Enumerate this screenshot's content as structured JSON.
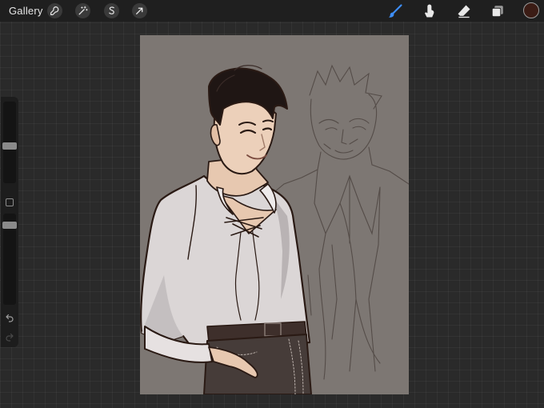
{
  "toolbar": {
    "gallery_label": "Gallery",
    "left_tools": [
      {
        "icon": "wrench-icon",
        "name": "actions"
      },
      {
        "icon": "magic-wand-icon",
        "name": "adjustments"
      },
      {
        "icon": "selection-s-icon",
        "name": "selection"
      },
      {
        "icon": "arrow-cursor-icon",
        "name": "transform"
      }
    ],
    "right_tools": [
      {
        "icon": "brush-icon",
        "name": "paint",
        "active": true
      },
      {
        "icon": "smudge-finger-icon",
        "name": "smudge",
        "active": false
      },
      {
        "icon": "eraser-icon",
        "name": "eraser",
        "active": false
      },
      {
        "icon": "layers-icon",
        "name": "layers",
        "active": false
      }
    ],
    "current_color": "#3b1c15",
    "accent_color": "#3d8df5"
  },
  "sidebar": {
    "brush_size_level": 0.45,
    "opacity_level": 0.9,
    "modify_icon": "square-icon",
    "undo_icon": "undo-arrow-icon",
    "redo_icon": "redo-arrow-icon"
  },
  "canvas": {
    "background_color": "#7d7773",
    "content": "illustration-artwork"
  }
}
